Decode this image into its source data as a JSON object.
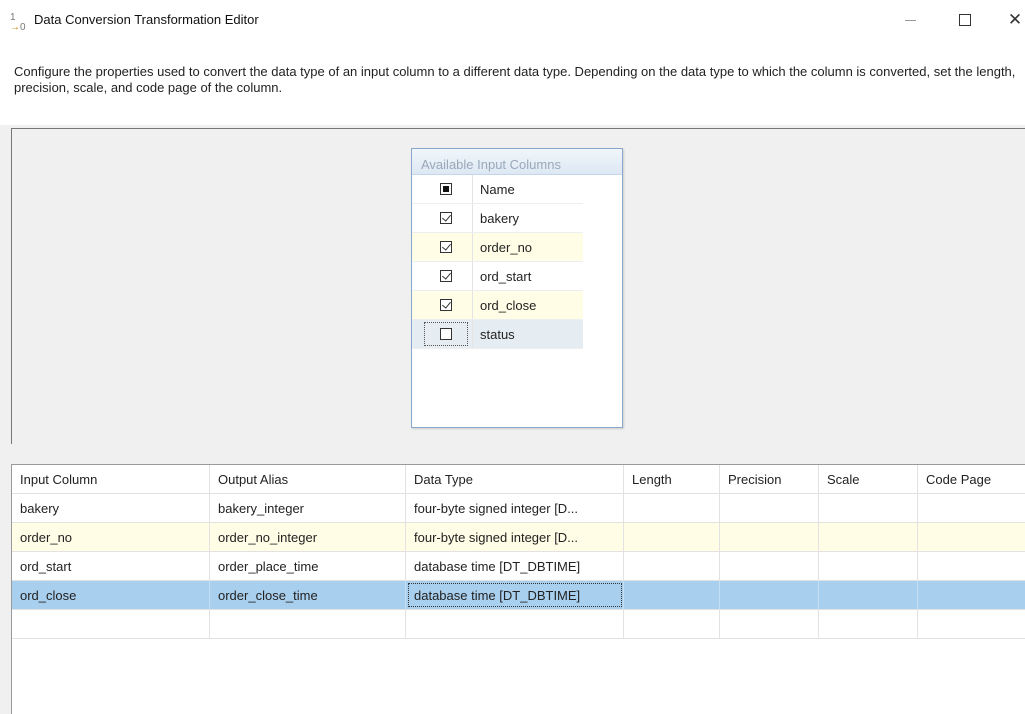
{
  "window": {
    "title": "Data Conversion Transformation Editor",
    "icon": "data-conversion-icon"
  },
  "description": "Configure the properties used to convert the data type of an input column to a different data type. Depending on the data type to which the column is converted, set the length, precision, scale, and code page of the column.",
  "available_columns": {
    "header": "Available Input Columns",
    "name_header": "Name",
    "select_all_state": "indeterminate",
    "rows": [
      {
        "name": "bakery",
        "checked": true
      },
      {
        "name": "order_no",
        "checked": true
      },
      {
        "name": "ord_start",
        "checked": true
      },
      {
        "name": "ord_close",
        "checked": true
      },
      {
        "name": "status",
        "checked": false
      }
    ]
  },
  "grid": {
    "headers": [
      "Input Column",
      "Output Alias",
      "Data Type",
      "Length",
      "Precision",
      "Scale",
      "Code Page"
    ],
    "rows": [
      [
        "bakery",
        "bakery_integer",
        "four-byte signed integer [D...",
        "",
        "",
        "",
        ""
      ],
      [
        "order_no",
        "order_no_integer",
        "four-byte signed integer [D...",
        "",
        "",
        "",
        ""
      ],
      [
        "ord_start",
        "order_place_time",
        "database time [DT_DBTIME]",
        "",
        "",
        "",
        ""
      ],
      [
        "ord_close",
        "order_close_time",
        "database time [DT_DBTIME]",
        "",
        "",
        "",
        ""
      ],
      [
        "",
        "",
        "",
        "",
        "",
        "",
        ""
      ]
    ],
    "selected_row_index": 3
  },
  "colors": {
    "selection": "#a9cfee",
    "alt_row": "#fffde6",
    "panel": "#f0f0f0"
  }
}
